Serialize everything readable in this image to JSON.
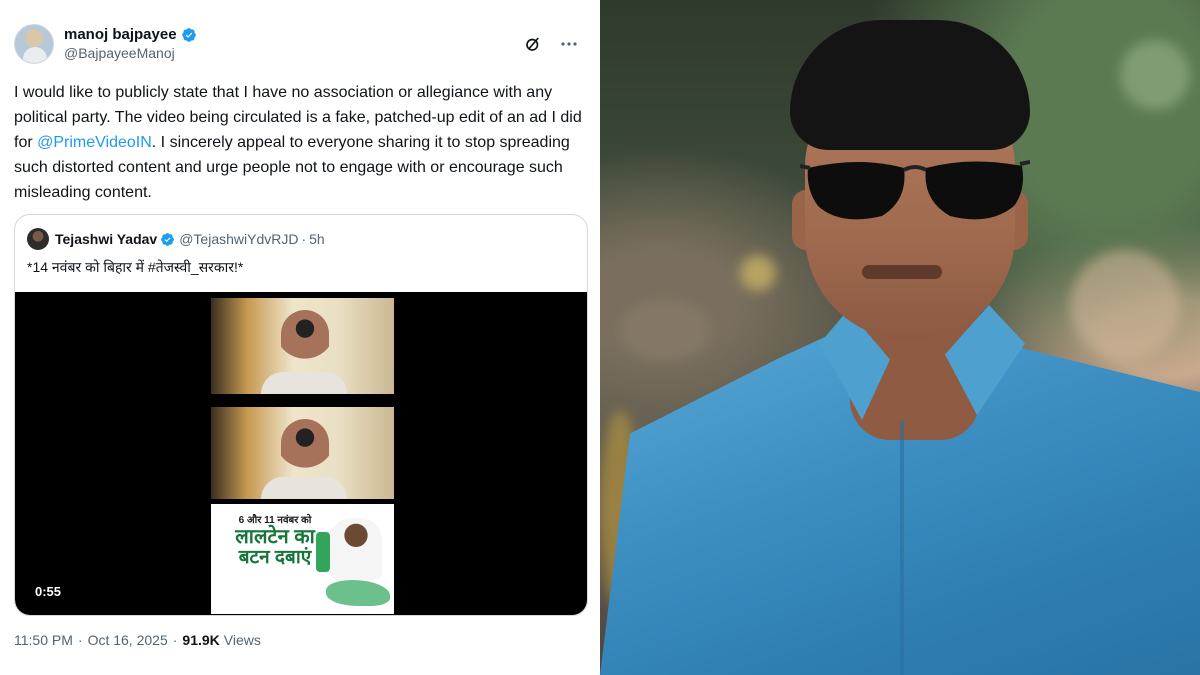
{
  "tweet": {
    "display_name": "manoj bajpayee",
    "handle": "@BajpayeeManoj",
    "text_part1": "I would like to publicly state that I have no association or allegiance with any political party. The video being circulated is a fake, patched-up edit of an ad I did for ",
    "mention": "@PrimeVideoIN",
    "text_part2": ". I sincerely appeal to everyone sharing it to stop spreading such distorted content and urge people not to engage with or encourage such misleading content.",
    "time": "11:50 PM",
    "date": "Oct 16, 2025",
    "views_count": "91.9K",
    "views_label": "Views",
    "separator": "·"
  },
  "quote": {
    "display_name": "Tejashwi Yadav",
    "handle": "@TejashwiYdvRJD",
    "separator": "·",
    "time_ago": "5h",
    "text": "*14 नवंबर को बिहार में #तेजस्वी_सरकार!*",
    "video_duration": "0:55",
    "poster": {
      "line1": "6 और 11 नवंबर को",
      "line2": "लालटेन का",
      "line3": "बटन दबाएं"
    }
  },
  "colors": {
    "accent": "#1d9bf0",
    "text_primary": "#0f1419",
    "text_secondary": "#536471",
    "border": "#cfd9de"
  }
}
